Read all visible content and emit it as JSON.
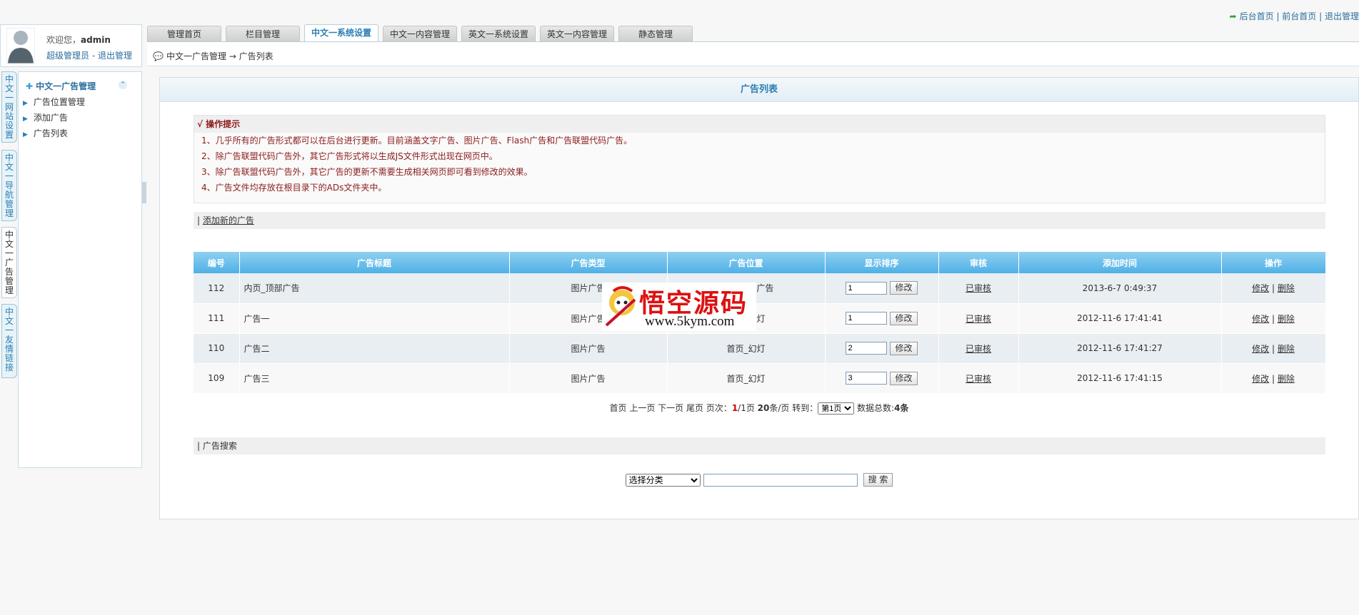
{
  "header": {
    "links": [
      "后台首页",
      "前台首页",
      "退出管理"
    ],
    "separator": " | "
  },
  "user": {
    "welcome": "欢迎您，",
    "name": "admin",
    "role": "超级管理员",
    "dash": " - ",
    "logout": "退出管理"
  },
  "tabs": [
    {
      "label": "管理首页",
      "active": false
    },
    {
      "label": "栏目管理",
      "active": false
    },
    {
      "label": "中文一系统设置",
      "active": true
    },
    {
      "label": "中文一内容管理",
      "active": false
    },
    {
      "label": "英文一系统设置",
      "active": false
    },
    {
      "label": "英文一内容管理",
      "active": false
    },
    {
      "label": "静态管理",
      "active": false
    }
  ],
  "breadcrumb": {
    "part1": "中文一广告管理",
    "arrow": " → ",
    "part2": "广告列表"
  },
  "vertical_tabs": [
    {
      "label": "中文一网站设置",
      "active": false
    },
    {
      "label": "中文一导航管理",
      "active": false
    },
    {
      "label": "中文一广告管理",
      "active": true
    },
    {
      "label": "中文一友情链接",
      "active": false
    }
  ],
  "sidebar": {
    "heading": "中文一广告管理",
    "items": [
      "广告位置管理",
      "添加广告",
      "广告列表"
    ]
  },
  "main": {
    "title": "广告列表",
    "tips_title": "√ 操作提示",
    "tips": [
      "1、几乎所有的广告形式都可以在后台进行更新。目前涵盖文字广告、图片广告、Flash广告和广告联盟代码广告。",
      "2、除广告联盟代码广告外，其它广告形式将以生成JS文件形式出现在网页中。",
      "3、除广告联盟代码广告外，其它广告的更新不需要生成相关网页即可看到修改的效果。",
      "4、广告文件均存放在根目录下的ADs文件夹中。"
    ],
    "add_prefix": "| ",
    "add_link": "添加新的广告",
    "search_title": "| 广告搜索"
  },
  "table": {
    "headers": [
      "编号",
      "广告标题",
      "广告类型",
      "广告位置",
      "显示排序",
      "审核",
      "添加时间",
      "操作"
    ],
    "rows": [
      {
        "id": "112",
        "title": "内页_顶部广告",
        "type": "图片广告",
        "position": "内页_顶部广告",
        "order": "1",
        "status": "已审核",
        "time": "2013-6-7 0:49:37"
      },
      {
        "id": "111",
        "title": "广告一",
        "type": "图片广告",
        "position": "首页_幻灯",
        "order": "1",
        "status": "已审核",
        "time": "2012-11-6 17:41:41"
      },
      {
        "id": "110",
        "title": "广告二",
        "type": "图片广告",
        "position": "首页_幻灯",
        "order": "2",
        "status": "已审核",
        "time": "2012-11-6 17:41:27"
      },
      {
        "id": "109",
        "title": "广告三",
        "type": "图片广告",
        "position": "首页_幻灯",
        "order": "3",
        "status": "已审核",
        "time": "2012-11-6 17:41:15"
      }
    ],
    "save_label": "修改",
    "edit_label": "修改",
    "delete_label": "删除",
    "sep": " | "
  },
  "pager": {
    "nav": "首页 上一页 下一页 尾页 页次：",
    "current": "1",
    "total": "/1页 ",
    "per_page": "20",
    "per_page_suffix": "条/页 转到：",
    "goto_value": "第1页",
    "count_label": " 数据总数:",
    "count": "4条"
  },
  "search": {
    "category_value": "选择分类",
    "button": "搜 索"
  },
  "watermark": {
    "title": "悟空源码",
    "url": "www.5kym.com"
  },
  "colors": {
    "accent": "#2a7fb4",
    "table_header": "#4fb0e6",
    "tip_text": "#8b1b1b",
    "watermark_red": "#dd1111"
  }
}
